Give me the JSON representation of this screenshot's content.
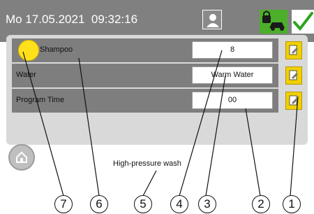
{
  "header": {
    "datetime": "Mo 17.05.2021  09:32:16",
    "icons": {
      "user": "user-icon",
      "lock": "lock-car-icon",
      "confirm": "check-icon"
    },
    "colors": {
      "header_bg": "#808080",
      "confirm_green": "#2ea21f",
      "lock_green": "#4caf2a"
    }
  },
  "rows": [
    {
      "label": "Shampoo",
      "value": "8"
    },
    {
      "label": "Water",
      "value": "Warm Water"
    },
    {
      "label": "Program Time",
      "value": "00"
    }
  ],
  "indicator": {
    "state": "on",
    "color": "#ffe01a"
  },
  "side_buttons": [
    "edit-icon",
    "edit-icon",
    "edit-icon"
  ],
  "program_label": "High-pressure wash",
  "callouts": [
    "1",
    "2",
    "3",
    "4",
    "5",
    "6",
    "7"
  ]
}
